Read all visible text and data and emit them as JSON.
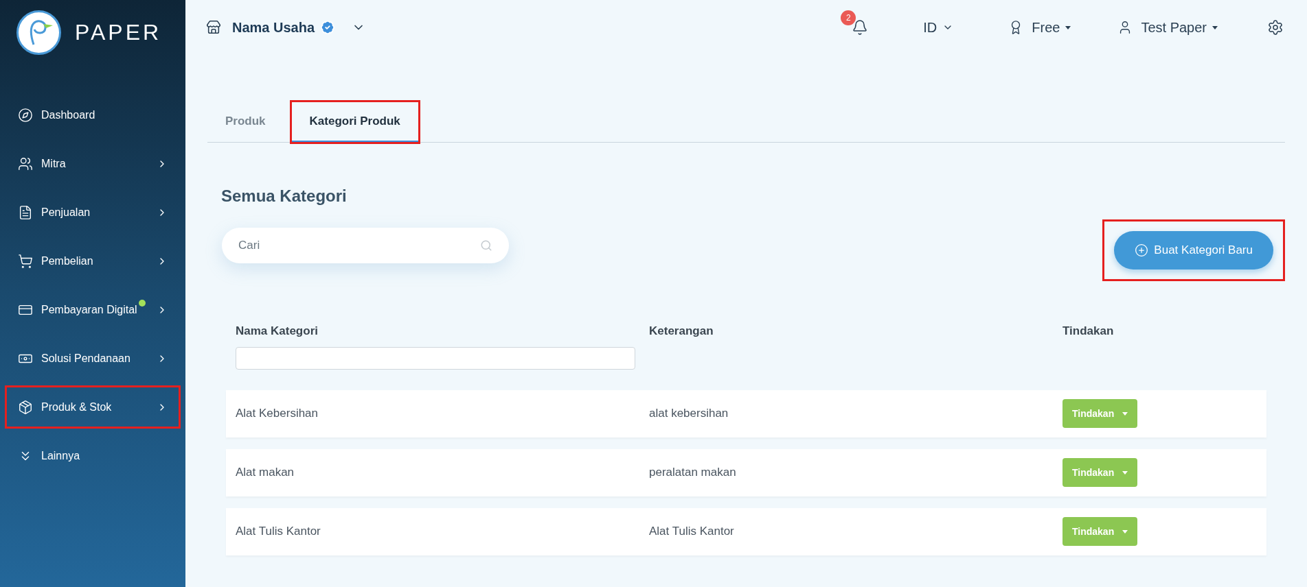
{
  "brand": {
    "name": "PAPER"
  },
  "sidebar": {
    "items": [
      {
        "label": "Dashboard",
        "kind": "compass",
        "has_submenu": false,
        "dot": false,
        "highlighted": false
      },
      {
        "label": "Mitra",
        "kind": "users",
        "has_submenu": true,
        "dot": false,
        "highlighted": false
      },
      {
        "label": "Penjualan",
        "kind": "document",
        "has_submenu": true,
        "dot": false,
        "highlighted": false
      },
      {
        "label": "Pembelian",
        "kind": "cart",
        "has_submenu": true,
        "dot": false,
        "highlighted": false
      },
      {
        "label": "Pembayaran Digital",
        "kind": "card",
        "has_submenu": true,
        "dot": true,
        "highlighted": false
      },
      {
        "label": "Solusi Pendanaan",
        "kind": "money",
        "has_submenu": true,
        "dot": false,
        "highlighted": false
      },
      {
        "label": "Produk & Stok",
        "kind": "box",
        "has_submenu": true,
        "dot": false,
        "highlighted": true
      },
      {
        "label": "Lainnya",
        "kind": "more",
        "has_submenu": false,
        "dot": false,
        "highlighted": false
      }
    ]
  },
  "topbar": {
    "business": "Nama Usaha",
    "verified": true,
    "notifications": "2",
    "language": "ID",
    "plan": "Free",
    "user": "Test Paper"
  },
  "tabs": [
    {
      "label": "Produk",
      "selected": false,
      "highlighted": false
    },
    {
      "label": "Kategori Produk",
      "selected": true,
      "highlighted": true
    }
  ],
  "heading": "Semua Kategori",
  "search": {
    "placeholder": "Cari"
  },
  "create_button": {
    "label": "Buat Kategori Baru",
    "highlighted": true
  },
  "table": {
    "columns": [
      "Nama Kategori",
      "Keterangan",
      "Tindakan"
    ],
    "rows": [
      {
        "name": "Alat Kebersihan",
        "description": "alat kebersihan",
        "action": "Tindakan"
      },
      {
        "name": "Alat makan",
        "description": "peralatan makan",
        "action": "Tindakan"
      },
      {
        "name": "Alat Tulis Kantor",
        "description": "Alat Tulis Kantor",
        "action": "Tindakan"
      }
    ]
  }
}
